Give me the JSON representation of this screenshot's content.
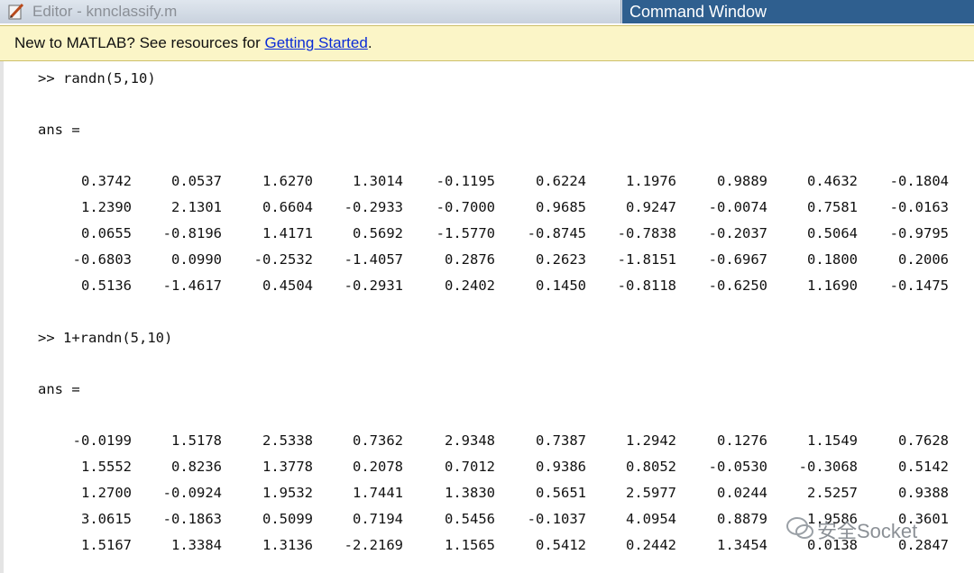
{
  "tabs": {
    "editor": "Editor - knnclassify.m",
    "command": "Command Window"
  },
  "banner": {
    "prefix": "New to MATLAB? See resources for ",
    "link": "Getting Started",
    "suffix": "."
  },
  "blocks": [
    {
      "command": ">> randn(5,10)",
      "ans": "ans =",
      "rows": [
        [
          "0.3742",
          "0.0537",
          "1.6270",
          "1.3014",
          "-0.1195",
          "0.6224",
          "1.1976",
          "0.9889",
          "0.4632",
          "-0.1804"
        ],
        [
          "1.2390",
          "2.1301",
          "0.6604",
          "-0.2933",
          "-0.7000",
          "0.9685",
          "0.9247",
          "-0.0074",
          "0.7581",
          "-0.0163"
        ],
        [
          "0.0655",
          "-0.8196",
          "1.4171",
          "0.5692",
          "-1.5770",
          "-0.8745",
          "-0.7838",
          "-0.2037",
          "0.5064",
          "-0.9795"
        ],
        [
          "-0.6803",
          "0.0990",
          "-0.2532",
          "-1.4057",
          "0.2876",
          "0.2623",
          "-1.8151",
          "-0.6967",
          "0.1800",
          "0.2006"
        ],
        [
          "0.5136",
          "-1.4617",
          "0.4504",
          "-0.2931",
          "0.2402",
          "0.1450",
          "-0.8118",
          "-0.6250",
          "1.1690",
          "-0.1475"
        ]
      ]
    },
    {
      "command": ">> 1+randn(5,10)",
      "ans": "ans =",
      "rows": [
        [
          "-0.0199",
          "1.5178",
          "2.5338",
          "0.7362",
          "2.9348",
          "0.7387",
          "1.2942",
          "0.1276",
          "1.1549",
          "0.7628"
        ],
        [
          "1.5552",
          "0.8236",
          "1.3778",
          "0.2078",
          "0.7012",
          "0.9386",
          "0.8052",
          "-0.0530",
          "-0.3068",
          "0.5142"
        ],
        [
          "1.2700",
          "-0.0924",
          "1.9532",
          "1.7441",
          "1.3830",
          "0.5651",
          "2.5977",
          "0.0244",
          "2.5257",
          "0.9388"
        ],
        [
          "3.0615",
          "-0.1863",
          "0.5099",
          "0.7194",
          "0.5456",
          "-0.1037",
          "4.0954",
          "0.8879",
          "1.9586",
          "0.3601"
        ],
        [
          "1.5167",
          "1.3384",
          "1.3136",
          "-2.2169",
          "1.1565",
          "0.5412",
          "0.2442",
          "1.3454",
          "0.0138",
          "0.2847"
        ]
      ]
    }
  ],
  "watermark": "安全Socket"
}
